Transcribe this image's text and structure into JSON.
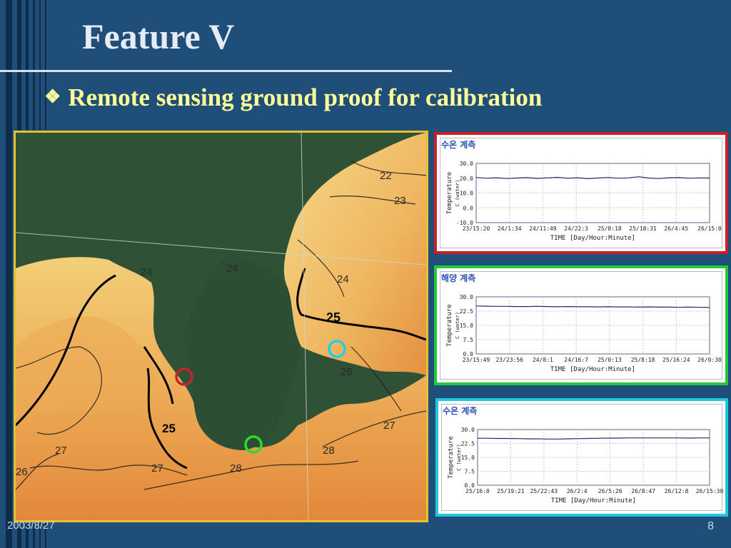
{
  "slide": {
    "title": "Feature V",
    "bullet_mark": "❖",
    "bullet": "Remote sensing ground proof for calibration",
    "date": "2003/8/27",
    "page_number": "8"
  },
  "map": {
    "contour_labels": [
      "22",
      "23",
      "24",
      "24",
      "24",
      "25",
      "25",
      "26",
      "26",
      "27",
      "27",
      "28",
      "28",
      "27"
    ],
    "markers": [
      {
        "color": "#c0262c",
        "name": "red-station"
      },
      {
        "color": "#1ed0e8",
        "name": "cyan-station"
      },
      {
        "color": "#2fd92f",
        "name": "green-station"
      }
    ]
  },
  "charts": [
    {
      "name": "red",
      "header": "수온 계측",
      "ylabel": "Temperature",
      "yunit": "C (water)",
      "yticks": [
        "30.0",
        "20.0",
        "10.0",
        "0.0",
        "-10.0"
      ],
      "xticks": [
        "23/15:20",
        "24/1:34",
        "24/11:49",
        "24/22:3",
        "25/8:18",
        "25/18:31",
        "26/4:45",
        "26/15:0"
      ],
      "xlabel": "TIME [Day/Hour:Minute]",
      "ymin": -10,
      "ymax": 30,
      "series": [
        20.5,
        20.0,
        20.3,
        19.8,
        20.1,
        20.4,
        19.9,
        20.2,
        20.6,
        20.0,
        20.3,
        19.7,
        20.1,
        20.5,
        20.0,
        20.2,
        21.0,
        20.1,
        19.8,
        20.3,
        20.4,
        20.0,
        20.2,
        20.1
      ]
    },
    {
      "name": "green",
      "header": "해양 계측",
      "ylabel": "Temperature",
      "yunit": "C (water)",
      "yticks": [
        "30.0",
        "22.5",
        "15.0",
        "7.5",
        "0.0"
      ],
      "xticks": [
        "23/15:49",
        "23/23:56",
        "24/8:1",
        "24/16:7",
        "25/0:13",
        "25/8:18",
        "25/16:24",
        "26/0:30"
      ],
      "xlabel": "TIME [Day/Hour:Minute]",
      "ymin": 0,
      "ymax": 30,
      "series": [
        25.2,
        25.1,
        25.0,
        25.0,
        24.9,
        24.9,
        25.0,
        24.9,
        24.8,
        24.9,
        24.8,
        24.8,
        24.7,
        24.8,
        24.7,
        24.7,
        24.6,
        24.7,
        24.6,
        24.6,
        24.5,
        24.6,
        24.5,
        24.4
      ]
    },
    {
      "name": "cyan",
      "header": "수온 계측",
      "ylabel": "Temperature",
      "yunit": "C (water)",
      "yticks": [
        "30.0",
        "22.5",
        "15.0",
        "7.5",
        "0.0"
      ],
      "xticks": [
        "25/16:0",
        "25/19:21",
        "25/22:43",
        "26/2:4",
        "26/5:26",
        "26/8:47",
        "26/12:8",
        "26/15:30"
      ],
      "xlabel": "TIME [Day/Hour:Minute]",
      "ymin": 0,
      "ymax": 30,
      "series": [
        25.3,
        25.3,
        25.2,
        25.2,
        25.1,
        25.0,
        25.0,
        24.9,
        24.9,
        25.0,
        25.1,
        25.2,
        25.3,
        25.4,
        25.4,
        25.5,
        25.5,
        25.5,
        25.5,
        25.5,
        25.5,
        25.4,
        25.5,
        25.5
      ]
    }
  ]
}
